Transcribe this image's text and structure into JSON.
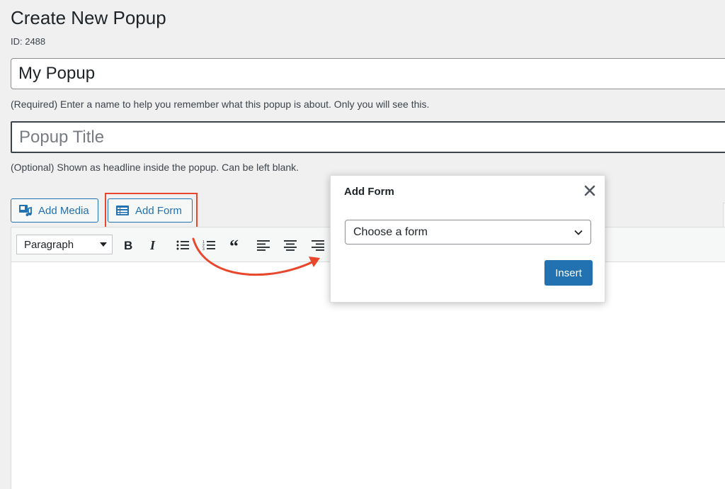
{
  "page": {
    "title": "Create New Popup",
    "id_label": "ID: 2488"
  },
  "name_field": {
    "value": "My Popup",
    "help": "(Required) Enter a name to help you remember what this popup is about. Only you will see this."
  },
  "title_field": {
    "value": "",
    "placeholder": "Popup Title",
    "help": "(Optional) Shown as headline inside the popup. Can be left blank."
  },
  "media_buttons": {
    "add_media": "Add Media",
    "add_form": "Add Form"
  },
  "toolbar": {
    "format_select": "Paragraph",
    "buttons": [
      "bold",
      "italic",
      "bullet-list",
      "numbered-list",
      "blockquote",
      "align-left",
      "align-center",
      "align-right"
    ]
  },
  "dialog": {
    "title": "Add Form",
    "select_value": "Choose a form",
    "insert_label": "Insert"
  },
  "colors": {
    "accent": "#2271b1",
    "highlight": "#e8462d"
  }
}
